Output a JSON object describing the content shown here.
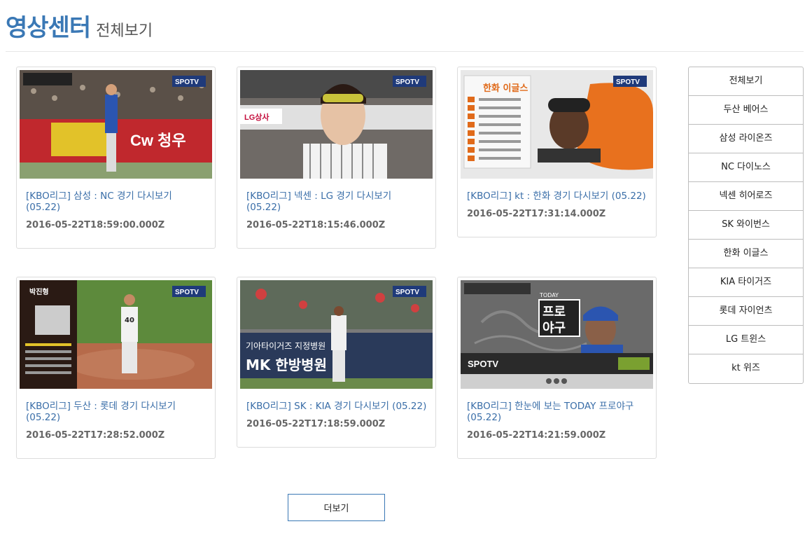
{
  "header": {
    "title": "영상센터",
    "subtitle": "전체보기"
  },
  "videos": [
    {
      "title": "[KBO리그] 삼성 : NC 경기 다시보기 (05.22)",
      "date": "2016-05-22T18:59:00.000Z",
      "thumb_text": "SPOTV"
    },
    {
      "title": "[KBO리그] 넥센 : LG 경기 다시보기 (05.22)",
      "date": "2016-05-22T18:15:46.000Z",
      "thumb_text": "SPOTV"
    },
    {
      "title": "[KBO리그] kt : 한화 경기 다시보기 (05.22)",
      "date": "2016-05-22T17:31:14.000Z",
      "thumb_text": "SPOTV"
    },
    {
      "title": "[KBO리그] 두산 : 롯데 경기 다시보기 (05.22)",
      "date": "2016-05-22T17:28:52.000Z",
      "thumb_text": "SPOTV"
    },
    {
      "title": "[KBO리그] SK : KIA 경기 다시보기 (05.22)",
      "date": "2016-05-22T17:18:59.000Z",
      "thumb_text": "SPOTV"
    },
    {
      "title": "[KBO리그] 한눈에 보는 TODAY 프로야구 (05.22)",
      "date": "2016-05-22T14:21:59.000Z",
      "thumb_text": "SPOTV"
    }
  ],
  "categories": [
    "전체보기",
    "두산 베어스",
    "삼성 라이온즈",
    "NC 다이노스",
    "넥센 히어로즈",
    "SK 와이번스",
    "한화 이글스",
    "KIA 타이거즈",
    "롯데 자이언츠",
    "LG 트윈스",
    "kt 위즈"
  ],
  "more_button": "더보기",
  "thumb_labels": {
    "v1_sign": "Cw 청우",
    "v2_sign": "LG상사",
    "v3_heading": "한화 이글스",
    "v4_name": "박진형",
    "v5_sign": "MK 한방병원",
    "v5_top": "기아타이거즈 지정병원",
    "v6_line1": "프로",
    "v6_line2": "야구",
    "v6_today": "TODAY"
  },
  "colors": {
    "accent": "#3a78b5",
    "link": "#3a6ea8"
  }
}
